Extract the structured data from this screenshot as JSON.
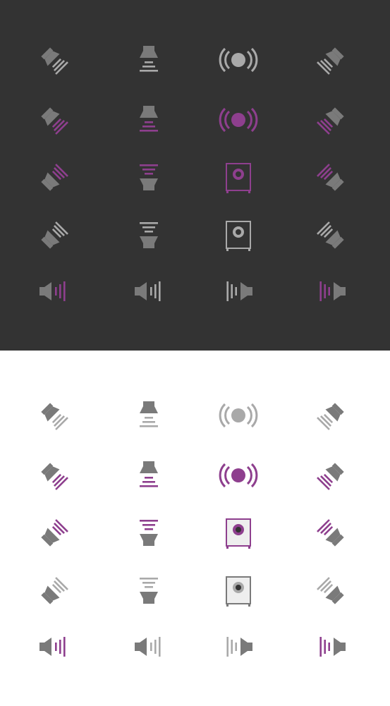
{
  "colors": {
    "dark_background": "#333333",
    "light_background": "#ffffff",
    "icon_gray": "#7a7a7a",
    "icon_gray_light": "#a9a9a9",
    "accent_purple": "#8e3f8e",
    "light_panel_speaker_fill": "#eeeeee",
    "light_panel_cone_fill": "#333333"
  },
  "panels": [
    {
      "name": "dark-panel",
      "theme": "dark",
      "rows": [
        [
          "front-left-speaker-icon",
          "center-speaker-icon",
          "surround-speaker-icon",
          "front-right-speaker-icon"
        ],
        [
          "front-left-speaker-icon-active",
          "center-speaker-icon-active",
          "surround-speaker-icon-active",
          "front-right-speaker-icon-active"
        ],
        [
          "rear-left-speaker-icon-active",
          "rear-center-speaker-icon-active",
          "subwoofer-icon-active",
          "rear-right-speaker-icon-active"
        ],
        [
          "rear-left-speaker-icon",
          "rear-center-speaker-icon",
          "subwoofer-icon",
          "rear-right-speaker-icon"
        ],
        [
          "side-left-speaker-icon-active",
          "side-left-speaker-icon",
          "side-right-speaker-icon",
          "side-right-speaker-icon-active"
        ]
      ]
    },
    {
      "name": "light-panel",
      "theme": "light",
      "rows": [
        [
          "front-left-speaker-icon",
          "center-speaker-icon",
          "surround-speaker-icon",
          "front-right-speaker-icon"
        ],
        [
          "front-left-speaker-icon-active",
          "center-speaker-icon-active",
          "surround-speaker-icon-active",
          "front-right-speaker-icon-active"
        ],
        [
          "rear-left-speaker-icon-active",
          "rear-center-speaker-icon-active",
          "subwoofer-icon-active",
          "rear-right-speaker-icon-active"
        ],
        [
          "rear-left-speaker-icon",
          "rear-center-speaker-icon",
          "subwoofer-icon",
          "rear-right-speaker-icon"
        ],
        [
          "side-left-speaker-icon-active",
          "side-left-speaker-icon",
          "side-right-speaker-icon",
          "side-right-speaker-icon-active"
        ]
      ]
    }
  ]
}
